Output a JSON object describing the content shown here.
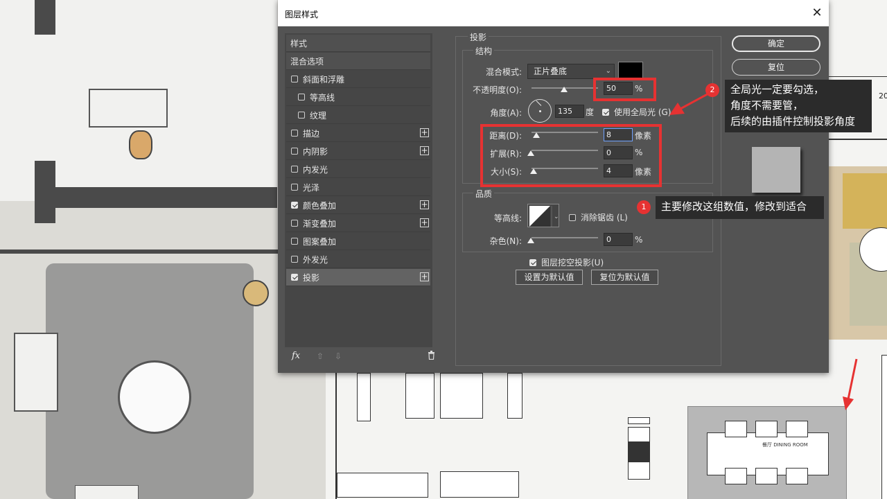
{
  "dialog": {
    "title": "图层样式",
    "close_symbol": "✕"
  },
  "style_list": {
    "header_styles": "样式",
    "header_blend": "混合选项",
    "items": [
      {
        "label": "斜面和浮雕",
        "checked": false,
        "plus": false,
        "indent": false
      },
      {
        "label": "等高线",
        "checked": false,
        "plus": false,
        "indent": true
      },
      {
        "label": "纹理",
        "checked": false,
        "plus": false,
        "indent": true
      },
      {
        "label": "描边",
        "checked": false,
        "plus": true,
        "indent": false
      },
      {
        "label": "内阴影",
        "checked": false,
        "plus": true,
        "indent": false
      },
      {
        "label": "内发光",
        "checked": false,
        "plus": false,
        "indent": false
      },
      {
        "label": "光泽",
        "checked": false,
        "plus": false,
        "indent": false
      },
      {
        "label": "颜色叠加",
        "checked": true,
        "plus": true,
        "indent": false
      },
      {
        "label": "渐变叠加",
        "checked": false,
        "plus": true,
        "indent": false
      },
      {
        "label": "图案叠加",
        "checked": false,
        "plus": false,
        "indent": false
      },
      {
        "label": "外发光",
        "checked": false,
        "plus": false,
        "indent": false
      },
      {
        "label": "投影",
        "checked": true,
        "plus": true,
        "indent": false,
        "selected": true
      }
    ],
    "footer": {
      "fx": "fx",
      "up": "⇧",
      "down": "⇩",
      "trash": "🗑"
    }
  },
  "drop_shadow": {
    "legend": "投影",
    "structure": {
      "legend": "结构",
      "blend_mode_label": "混合模式:",
      "blend_mode_value": "正片叠底",
      "opacity_label": "不透明度(O):",
      "opacity_value": "50",
      "opacity_unit": "%",
      "angle_label": "角度(A):",
      "angle_value": "135",
      "angle_unit": "度",
      "global_light_label": "使用全局光 (G)",
      "global_light_checked": true,
      "distance_label": "距离(D):",
      "distance_value": "8",
      "distance_unit": "像素",
      "spread_label": "扩展(R):",
      "spread_value": "0",
      "spread_unit": "%",
      "size_label": "大小(S):",
      "size_value": "4",
      "size_unit": "像素",
      "shadow_color": "#000000"
    },
    "quality": {
      "legend": "品质",
      "contour_label": "等高线:",
      "antialias_label": "消除锯齿 (L)",
      "antialias_checked": false,
      "noise_label": "杂色(N):",
      "noise_value": "0",
      "noise_unit": "%"
    },
    "knockout_label": "图层挖空投影(U)",
    "knockout_checked": true,
    "make_default": "设置为默认值",
    "reset_default": "复位为默认值"
  },
  "side_buttons": {
    "ok": "确定",
    "reset": "复位"
  },
  "annotations": {
    "badge1": "1",
    "note1": "主要修改这组数值，修改到适合",
    "badge2": "2",
    "note2_lines": [
      "全局光一定要勾选，",
      "角度不需要管，",
      "后续的由插件控制投影角度"
    ],
    "accent": "#e63232"
  },
  "background": {
    "dining_label": "餐厅 DINING ROOM",
    "right_edge_number": "20"
  }
}
